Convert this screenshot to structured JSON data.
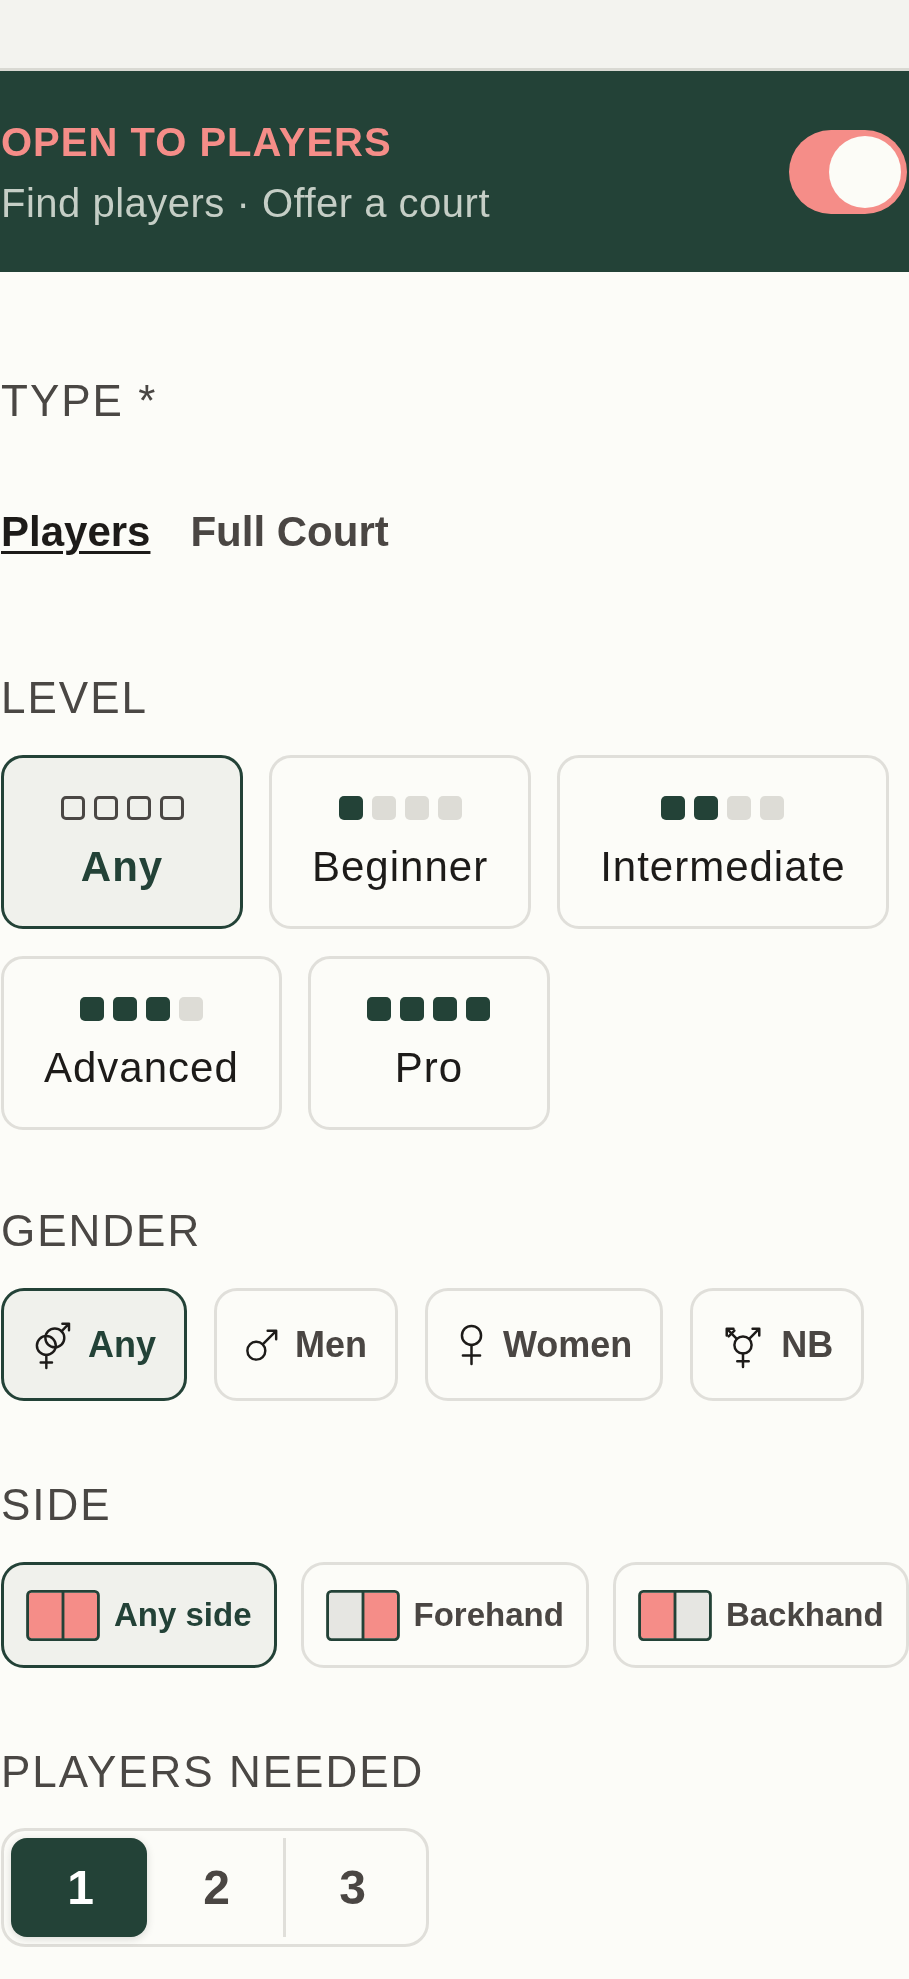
{
  "banner": {
    "title": "OPEN TO PLAYERS",
    "subtitle": "Find players · Offer a court",
    "toggle": {
      "on": true
    }
  },
  "type": {
    "label": "TYPE *",
    "tabs": [
      {
        "label": "Players",
        "selected": true
      },
      {
        "label": "Full Court",
        "selected": false
      }
    ]
  },
  "level": {
    "label": "LEVEL",
    "options": [
      {
        "label": "Any",
        "kind": "any",
        "selected": true
      },
      {
        "label": "Beginner",
        "kind": "rated",
        "stars": 1,
        "selected": false
      },
      {
        "label": "Intermediate",
        "kind": "rated",
        "stars": 2,
        "selected": false
      },
      {
        "label": "Advanced",
        "kind": "rated",
        "stars": 3,
        "selected": false
      },
      {
        "label": "Pro",
        "kind": "rated",
        "stars": 4,
        "selected": false
      }
    ]
  },
  "gender": {
    "label": "GENDER",
    "options": [
      {
        "label": "Any",
        "kind": "any",
        "selected": true
      },
      {
        "label": "Men",
        "kind": "male",
        "selected": false
      },
      {
        "label": "Women",
        "kind": "female",
        "selected": false
      },
      {
        "label": "NB",
        "kind": "nonbinary",
        "selected": false
      }
    ]
  },
  "side": {
    "label": "SIDE",
    "options": [
      {
        "label": "Any side",
        "kind": "both",
        "selected": true
      },
      {
        "label": "Forehand",
        "kind": "right",
        "selected": false
      },
      {
        "label": "Backhand",
        "kind": "left",
        "selected": false
      }
    ]
  },
  "players_needed": {
    "label": "PLAYERS NEEDED",
    "options": [
      {
        "label": "1",
        "selected": true
      },
      {
        "label": "2",
        "selected": false
      },
      {
        "label": "3",
        "selected": false
      }
    ]
  }
}
